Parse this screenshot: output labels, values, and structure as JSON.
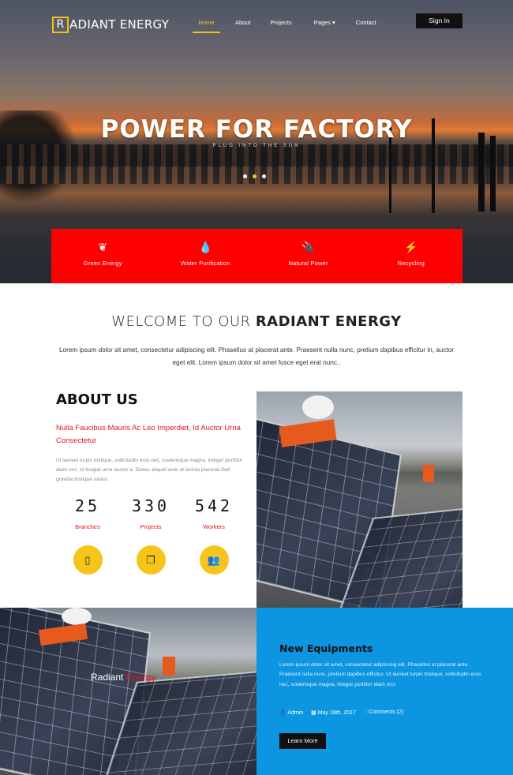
{
  "brand": {
    "logo_letter": "R",
    "logo_rest": "ADIANT ENERGY"
  },
  "nav": {
    "items": [
      {
        "label": "Home",
        "active": true
      },
      {
        "label": "About",
        "active": false
      },
      {
        "label": "Projects",
        "active": false
      },
      {
        "label": "Pages ▾",
        "active": false
      },
      {
        "label": "Contact",
        "active": false
      }
    ],
    "signin_label": "Sign In"
  },
  "hero": {
    "title": "POWER FOR FACTORY",
    "subtitle": "PLUG INTO THE SUN",
    "slides": 3,
    "active_slide": 2
  },
  "features": [
    {
      "icon": "leaf-icon",
      "glyph": "❦",
      "label": "Green Energy"
    },
    {
      "icon": "water-drop-icon",
      "glyph": "💧",
      "label": "Water Purification"
    },
    {
      "icon": "plug-icon",
      "glyph": "🔌",
      "label": "Natural Power"
    },
    {
      "icon": "lightning-icon",
      "glyph": "⚡",
      "label": "Recycling"
    }
  ],
  "welcome": {
    "title_prefix": "WELCOME TO OUR ",
    "title_bold": "RADIANT ENERGY",
    "text": "Lorem ipsum dolor sit amet, consectetur adipiscing elit. Phasellus at placerat ante. Praesent nulla nunc, pretium dapibus efficitur in, auctor eget elit. Lorem ipsum dolor sit amet fusce eget erat nunc.."
  },
  "about": {
    "title_bold": "ABOUT",
    "title_rest": " US",
    "subtitle": "Nulla Faucibus Mauris Ac Leo Imperdiet, Id Auctor Urna Consectetur",
    "text": "Ut laoreet turpis tristique, sollicitudin eros nec, scelerisque magna, integer porttitor diam orci. Id feugiat urna auctor a. Donec aliquet ante ut lacinia placerat.Sed gravida tristique varius.",
    "stats": [
      {
        "number": "25",
        "label": "Branches",
        "icon": "tablet-icon",
        "glyph": "▯"
      },
      {
        "number": "330",
        "label": "Projects",
        "icon": "copy-icon",
        "glyph": "❐"
      },
      {
        "number": "542",
        "label": "Workers",
        "icon": "users-icon",
        "glyph": "👥"
      }
    ]
  },
  "overlay": {
    "label_white": "Radiant ",
    "label_red": "Energy"
  },
  "equipment": {
    "title": "New Equipments",
    "text": "Lorem ipsum dolor sit amet, consectetur adipiscing elit, Phasellus at placerat ante. Praesent nulla nunc, pretium dapibus efficitur. Ut laoreet turpis tristique, sollicitudin eros nec, scelerisque magna, integer porttitor diam orci.",
    "meta_author": "Admin",
    "meta_date": "May 18th, 2017",
    "meta_comments": "Comments (2)",
    "button_label": "Learn More"
  },
  "colors": {
    "accent_yellow": "#f3c316",
    "feature_red": "#ff0000",
    "text_red": "#e0141c",
    "blue": "#0c95e0"
  }
}
